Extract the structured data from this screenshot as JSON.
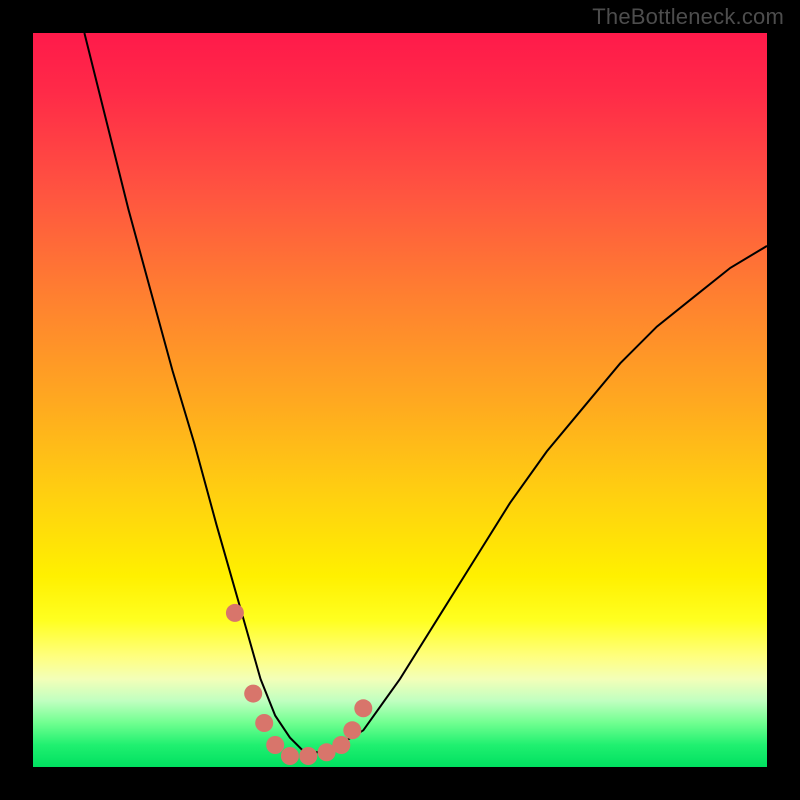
{
  "watermark": {
    "text": "TheBottleneck.com"
  },
  "chart_data": {
    "type": "line",
    "title": "",
    "xlabel": "",
    "ylabel": "",
    "xlim": [
      0,
      100
    ],
    "ylim": [
      0,
      100
    ],
    "gradient_stops": [
      {
        "pos": 0,
        "color": "#ff1a4a"
      },
      {
        "pos": 50,
        "color": "#ffa820"
      },
      {
        "pos": 80,
        "color": "#ffff20"
      },
      {
        "pos": 100,
        "color": "#00e060"
      }
    ],
    "series": [
      {
        "name": "bottleneck-curve",
        "color": "#000000",
        "width": 2,
        "x": [
          7,
          10,
          13,
          16,
          19,
          22,
          25,
          27,
          29,
          31,
          33,
          35,
          37,
          40,
          45,
          50,
          55,
          60,
          65,
          70,
          75,
          80,
          85,
          90,
          95,
          100
        ],
        "y": [
          100,
          88,
          76,
          65,
          54,
          44,
          33,
          26,
          19,
          12,
          7,
          4,
          2,
          2,
          5,
          12,
          20,
          28,
          36,
          43,
          49,
          55,
          60,
          64,
          68,
          71
        ]
      },
      {
        "name": "highlight-dots",
        "color": "#d8756b",
        "type": "scatter",
        "marker_size": 9,
        "x": [
          27.5,
          30,
          31.5,
          33,
          35,
          37.5,
          40,
          42,
          43.5,
          45
        ],
        "y": [
          21,
          10,
          6,
          3,
          1.5,
          1.5,
          2,
          3,
          5,
          8
        ]
      }
    ]
  }
}
